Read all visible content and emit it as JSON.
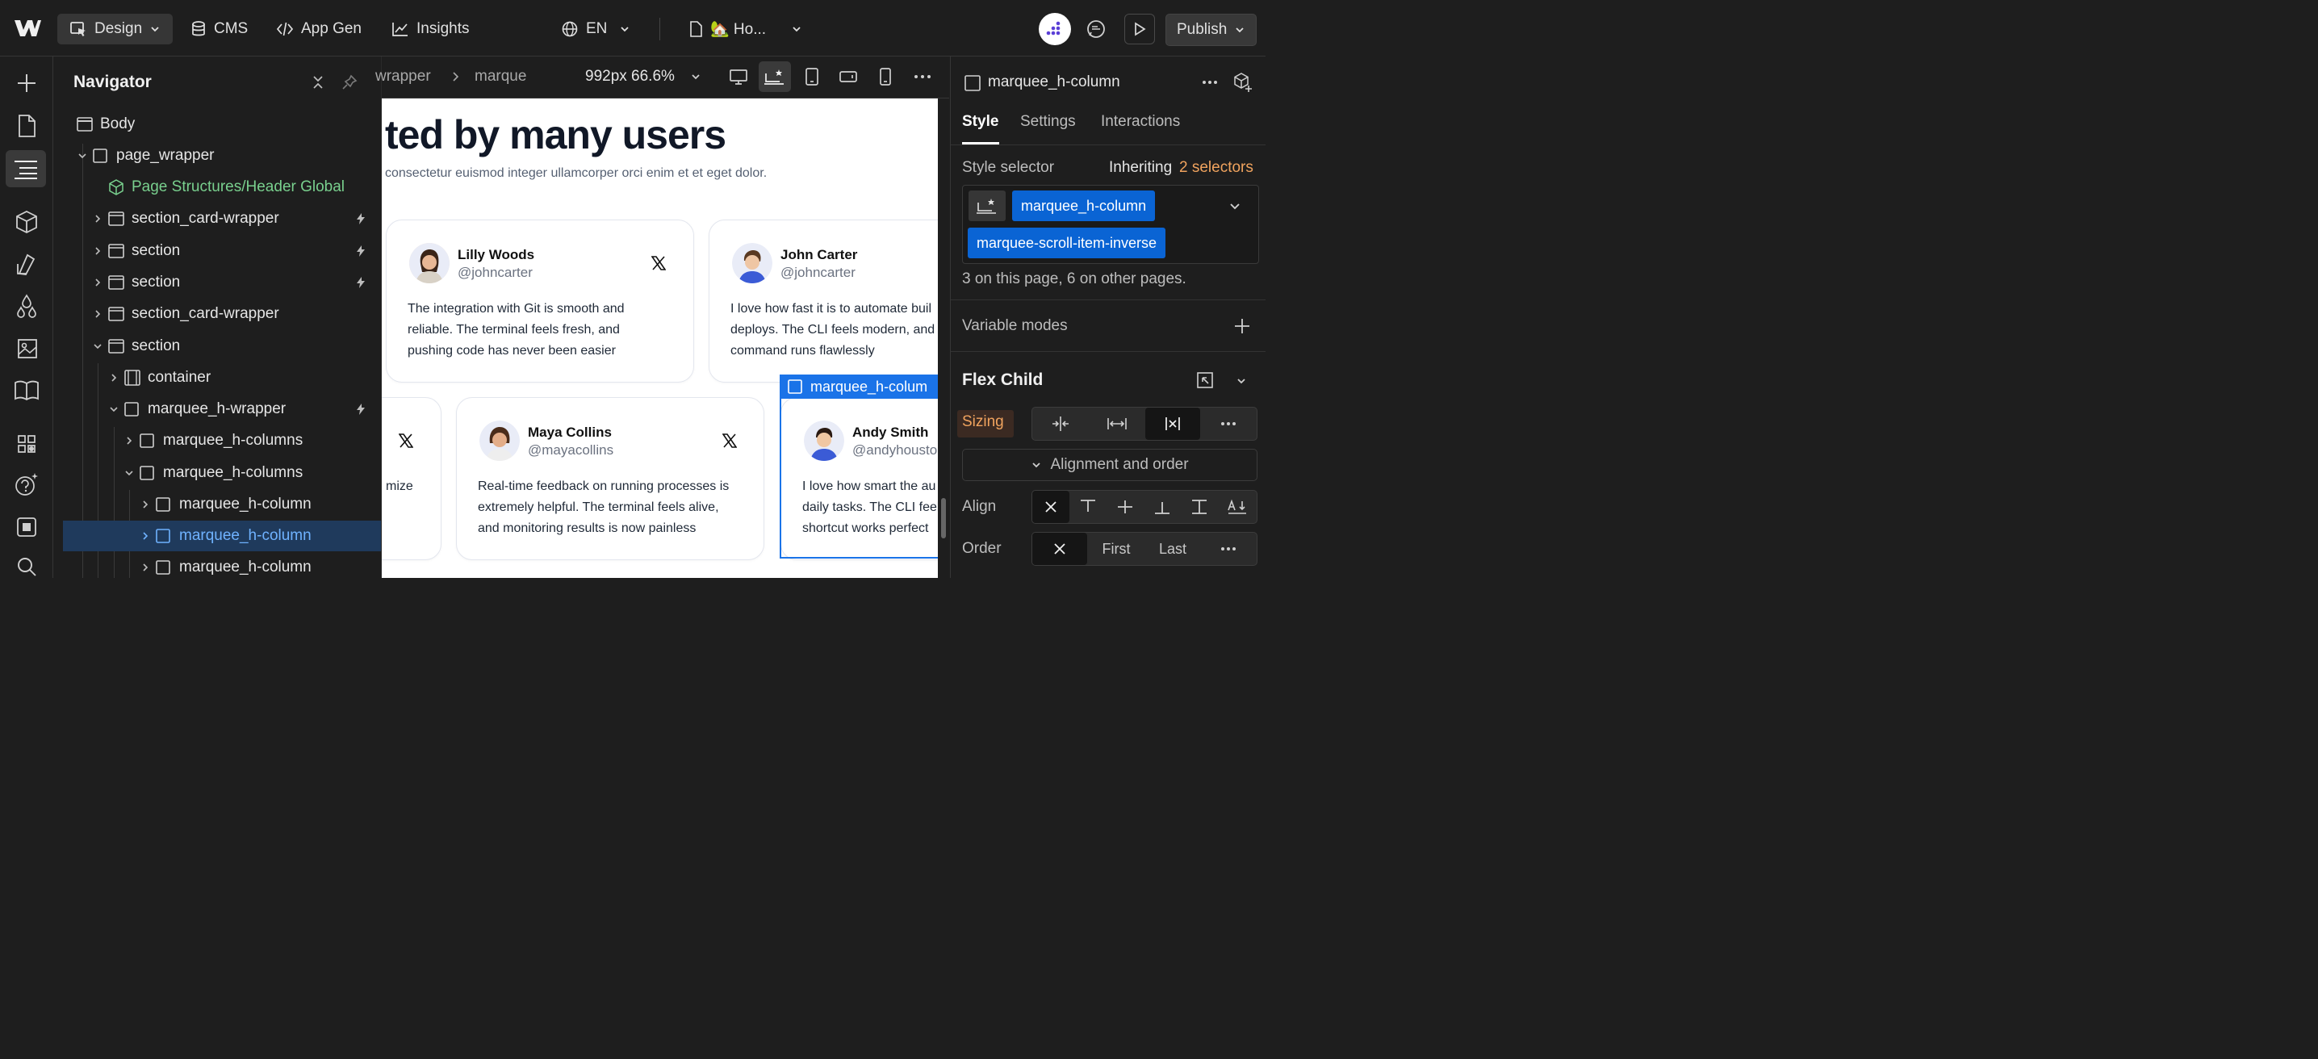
{
  "topbar": {
    "design_label": "Design",
    "cms_label": "CMS",
    "appgen_label": "App Gen",
    "insights_label": "Insights",
    "lang_label": "EN",
    "page_label": "🏡 Ho...",
    "publish_label": "Publish"
  },
  "navigator": {
    "title": "Navigator",
    "rows": [
      {
        "label": "Body"
      },
      {
        "label": "page_wrapper"
      },
      {
        "label": "Page Structures/Header Global"
      },
      {
        "label": "section_card-wrapper"
      },
      {
        "label": "section"
      },
      {
        "label": "section"
      },
      {
        "label": "section_card-wrapper"
      },
      {
        "label": "section"
      },
      {
        "label": "container"
      },
      {
        "label": "marquee_h-wrapper"
      },
      {
        "label": "marquee_h-columns"
      },
      {
        "label": "marquee_h-columns"
      },
      {
        "label": "marquee_h-column"
      },
      {
        "label": "marquee_h-column"
      },
      {
        "label": "marquee_h-column"
      }
    ]
  },
  "canvasbar": {
    "crumb1": "wrapper",
    "crumb2": "marque",
    "size": "992px 66.6%"
  },
  "canvas": {
    "heading": "ted by many users",
    "subheading": "consectetur euismod integer ullamcorper orci enim et et eget dolor.",
    "selected_label": "marquee_h-colum",
    "cards": [
      {
        "name": "Lilly Woods",
        "handle": "@johncarter",
        "lines": [
          "The integration with Git is smooth and",
          "reliable. The terminal feels fresh, and",
          "pushing code has never been easier"
        ]
      },
      {
        "name": "John Carter",
        "handle": "@johncarter",
        "lines": [
          "I love how fast it is to automate buil",
          "deploys. The CLI feels modern, and",
          "command runs flawlessly"
        ]
      },
      {
        "name": "",
        "handle": "",
        "lines": [
          "mize"
        ]
      },
      {
        "name": "Maya Collins",
        "handle": "@mayacollins",
        "lines": [
          "Real-time feedback on running processes is",
          "extremely helpful. The terminal feels alive,",
          "and monitoring results is now painless"
        ]
      },
      {
        "name": "Andy Smith",
        "handle": "@andyhoustor",
        "lines": [
          "I love how smart the au",
          "daily tasks. The CLI feel",
          "shortcut works perfect"
        ]
      }
    ]
  },
  "panel": {
    "element_name": "marquee_h-column",
    "tabs": [
      "Style",
      "Settings",
      "Interactions"
    ],
    "style_selector_label": "Style selector",
    "inheriting_label": "Inheriting",
    "selectors_count": "2 selectors",
    "chips": [
      "marquee_h-column",
      "marquee-scroll-item-inverse"
    ],
    "usage_text": "3 on this page, 6 on other pages.",
    "variable_modes": "Variable modes",
    "flex_child_title": "Flex Child",
    "sizing_label": "Sizing",
    "alignment_order": "Alignment and order",
    "align_label": "Align",
    "order_label": "Order",
    "order_first": "First",
    "order_last": "Last",
    "colors": {
      "accent": "#0a64d4",
      "selection": "#1f3a5c",
      "component": "#79d08e",
      "warn": "#f0a35e"
    }
  }
}
